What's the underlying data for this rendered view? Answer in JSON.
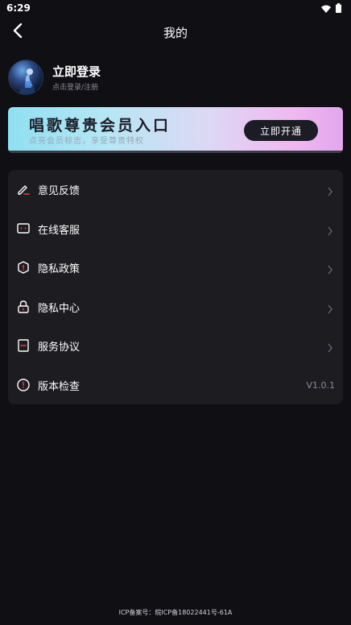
{
  "status_bar": {
    "time": "6:29"
  },
  "header": {
    "title": "我的"
  },
  "profile": {
    "name": "立即登录",
    "subtitle": "点击登录/注册"
  },
  "vip_banner": {
    "title": "唱歌尊贵会员入口",
    "subtitle": "点亮会员标志，享受尊贵特权",
    "button_label": "立即开通"
  },
  "menu": {
    "items": [
      {
        "label": "意见反馈",
        "icon": "edit-icon"
      },
      {
        "label": "在线客服",
        "icon": "chat-icon"
      },
      {
        "label": "隐私政策",
        "icon": "shield-icon"
      },
      {
        "label": "隐私中心",
        "icon": "lock-icon"
      },
      {
        "label": "服务协议",
        "icon": "document-icon"
      },
      {
        "label": "版本检查",
        "icon": "info-icon",
        "value": "V1.0.1"
      }
    ]
  },
  "footer": {
    "icp": "ICP备案号：皖ICP备18022441号-61A"
  },
  "colors": {
    "background": "#0f0f14",
    "card": "#1c1c21",
    "accent_red": "#e8384a"
  }
}
